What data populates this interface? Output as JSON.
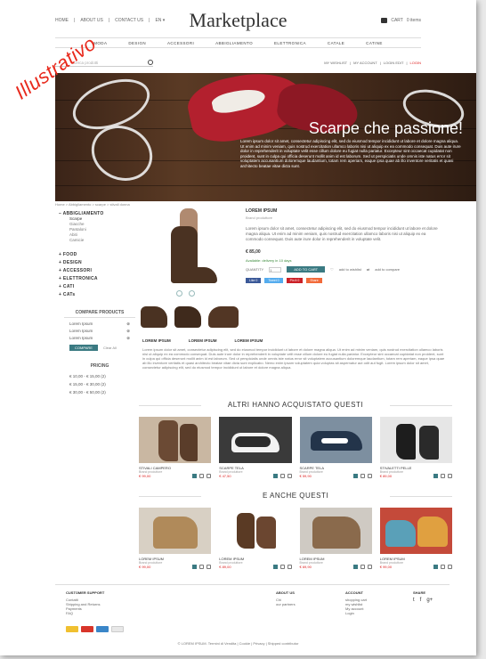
{
  "watermark": "Illustrativo",
  "header": {
    "links": [
      "HOME",
      "|",
      "ABOUT US",
      "|",
      "CONTACT US",
      "|",
      "EN ▾"
    ],
    "logo": "Marketplace",
    "cart_label": "CART",
    "cart_count": "0 items"
  },
  "nav": [
    "MODA",
    "DESIGN",
    "ACCESSORI",
    "ABBIGLIAMENTO",
    "ELETTRONICA",
    "CATALE",
    "CATINE"
  ],
  "search": {
    "placeholder": "Cerca prodotti"
  },
  "account_links": [
    "MY WISHLIST",
    "|",
    "MY ACCOUNT",
    "|",
    "LOGIN EDIT",
    "|",
    "LOGIN"
  ],
  "hero": {
    "title": "Scarpe che passione!",
    "text": "Lorem ipsum dolor sit amet, consectetur adipiscing elit, sed do eiusmod tempor incididunt ut labore et dolore magna aliqua. Ut enim ad minim veniam, quis nostrud exercitation ullamco laboris nisi ut aliquip ex ea commodo consequat. Duis aute irure dolor in reprehenderit in voluptate velit esse cillum dolore eu fugiat nulla pariatur. Excepteur sint occaecat cupidatat non proident, sunt in culpa qui officia deserunt mollit anim id est laborum. Sed ut perspiciatis unde omnis iste natus error sit voluptatem accusantium doloremque laudantium, totam rem aperiam, eaque ipsa quae ab illo inventore veritatis et quasi architecto beatae vitae dicta sunt."
  },
  "breadcrumb": "Home > Abbigliamento > scarpe > stivali donna",
  "sidebar": {
    "categories": [
      {
        "label": "ABBIGLIAMENTO",
        "sub": [
          "Scarpe",
          "Giacche",
          "Pantaloni",
          "Abiti",
          "Camicie"
        ]
      },
      {
        "label": "FOOD",
        "sub": []
      },
      {
        "label": "DESIGN",
        "sub": []
      },
      {
        "label": "ACCESSORI",
        "sub": []
      },
      {
        "label": "ELETTRONICA",
        "sub": []
      },
      {
        "label": "CATI",
        "sub": []
      },
      {
        "label": "CATs",
        "sub": []
      }
    ]
  },
  "compare": {
    "title": "COMPARE PRODUCTS",
    "items": [
      "Lorem Ipsum",
      "Lorem Ipsum",
      "Lorem Ipsum"
    ],
    "button": "COMPARE",
    "clear": "Clear All"
  },
  "pricing": {
    "title": "PRICING",
    "ranges": [
      "€ 10,00 - € 15,00 (2)",
      "€ 15,00 - € 30,00 (2)",
      "€ 30,00 - € 50,00 (2)"
    ]
  },
  "product": {
    "name": "LOREM IPSUM",
    "brand": "Brand produttore",
    "description": "Lorem ipsum dolor sit amet, consectetur adipiscing elit, sed do eiusmod tempor incididunt ut labore et dolore magna aliqua. Ut enim ad minim veniam, quis nostrud exercitation ullamco laboris nisi ut aliquip ex ea commodo consequat. Duis aute irure dolor in reprehenderit in voluptate velit.",
    "price": "€ 85,00",
    "availability": "Available: delivery in 10 days",
    "qty_label": "QUANTITY",
    "qty_value": "1",
    "add_button": "ADD TO CART",
    "wishlist": "add to wishlist",
    "compare": "add to compare",
    "social": [
      "Like 0",
      "Tweet 0",
      "Pin it 0",
      "Share"
    ]
  },
  "tabs": [
    "LOREM IPSUM",
    "LOREM IPSUM",
    "LOREM IPSUM"
  ],
  "tab_text": "Lorem ipsum dolor sit amet, consectetur adipiscing elit, sed do eiusmod tempor incididunt ut labore et dolore magna aliqua. Ut enim ad minim veniam, quis nostrud exercitation ullamco laboris nisi ut aliquip ex ea commodo consequat. Duis aute irure dolor in reprehenderit in voluptate velit esse cillum dolore eu fugiat nulla pariatur. Excepteur sint occaecat cupidatat non proident, sunt in culpa qui officia deserunt mollit anim id est laborum. Sed ut perspiciatis unde omnis iste natus error sit voluptatem accusantium doloremque laudantium, totam rem aperiam, eaque ipsa quae ab illo inventore veritatis et quasi architecto beatae vitae dicta sunt explicabo. Nemo enim ipsam voluptatem quia voluptas sit aspernatur aut odit aut fugit. Lorem ipsum dolor sit amet, consectetur adipiscing elit, sed do eiusmod tempor incididunt ut labore et dolore magna aliqua.",
  "also_bought": {
    "title": "ALTRI HANNO ACQUISTATO QUESTI",
    "items": [
      {
        "name": "STIVALI CAMPERO",
        "brand": "Brand produttore",
        "price": "€ 99,00"
      },
      {
        "name": "SCARPE TELA",
        "brand": "Brand produttore",
        "price": "€ 47,50"
      },
      {
        "name": "SCARPE TELA",
        "brand": "Brand produttore",
        "price": "€ 59,90"
      },
      {
        "name": "STIVALETTI PELLE",
        "brand": "Brand produttore",
        "price": "€ 89,00"
      }
    ]
  },
  "also_this": {
    "title": "E ANCHE QUESTI",
    "items": [
      {
        "name": "LOREM IPSUM",
        "brand": "Brand produttore",
        "price": "€ 99,00"
      },
      {
        "name": "LOREM IPSUM",
        "brand": "Brand produttore",
        "price": "€ 89,00"
      },
      {
        "name": "LOREM IPSUM",
        "brand": "Brand produttore",
        "price": "€ 69,90"
      },
      {
        "name": "LOREM IPSUM",
        "brand": "Brand produttore",
        "price": "€ 99,00"
      }
    ]
  },
  "footer": {
    "support": {
      "title": "CUSTOMER SUPPORT",
      "items": [
        "Contatti",
        "Shipping and Returns",
        "Payments",
        "FAQ"
      ]
    },
    "about": {
      "title": "ABOUT US",
      "items": [
        "Chi",
        "our partners"
      ]
    },
    "account": {
      "title": "ACCOUNT",
      "items": [
        "shopping cart",
        "my wishlist",
        "My account",
        "Login"
      ]
    },
    "share": {
      "title": "SHARE"
    },
    "copyright": "© LOREM IPSUM. Termini di Vendita | Cookie | Privacy | Shipped contributor"
  },
  "colors": {
    "accent": "#3a7a82",
    "price": "#dd2222",
    "hero_bg": "#4a2e1d"
  }
}
